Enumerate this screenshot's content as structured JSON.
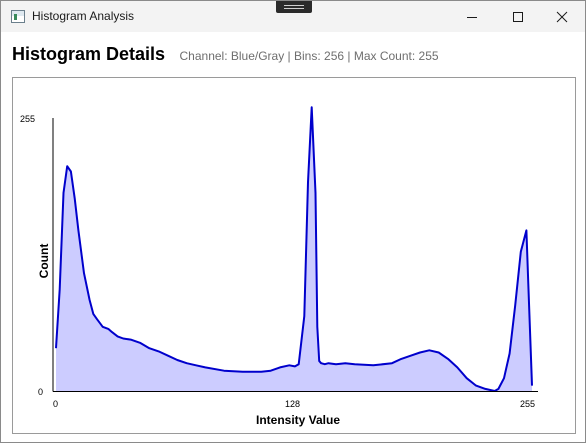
{
  "window": {
    "title": "Histogram Analysis"
  },
  "header": {
    "title": "Histogram Details",
    "subtitle": "Channel: Blue/Gray | Bins: 256 | Max Count: 255"
  },
  "colors": {
    "line": "#0000cc",
    "fill": "#ccccff",
    "axis": "#000000"
  },
  "chart_data": {
    "type": "area",
    "xlabel": "Intensity Value",
    "ylabel": "Count",
    "xlim": [
      0,
      255
    ],
    "ylim": [
      0,
      255
    ],
    "x_ticks": [
      "0",
      "128",
      "255"
    ],
    "y_ticks": [
      "0",
      "255"
    ],
    "grid": false,
    "x": [
      0,
      2,
      4,
      6,
      8,
      10,
      12,
      15,
      18,
      20,
      22,
      25,
      28,
      30,
      33,
      36,
      40,
      45,
      50,
      55,
      60,
      65,
      70,
      75,
      80,
      90,
      100,
      110,
      115,
      120,
      125,
      128,
      130,
      133,
      135,
      137,
      139,
      140,
      141,
      142,
      144,
      146,
      150,
      155,
      160,
      170,
      180,
      185,
      190,
      195,
      200,
      205,
      210,
      215,
      220,
      225,
      230,
      235,
      237,
      240,
      243,
      246,
      249,
      252,
      253,
      255
    ],
    "values": [
      40,
      95,
      185,
      210,
      205,
      180,
      150,
      110,
      85,
      72,
      67,
      60,
      58,
      55,
      51,
      49,
      48,
      45,
      40,
      37,
      33,
      29,
      26,
      24,
      22,
      19,
      18,
      18,
      19,
      22,
      24,
      23,
      25,
      70,
      195,
      265,
      185,
      60,
      28,
      26,
      25,
      26,
      25,
      26,
      25,
      24,
      26,
      30,
      33,
      36,
      38,
      36,
      30,
      22,
      12,
      5,
      2,
      0,
      2,
      12,
      35,
      80,
      130,
      150,
      100,
      5
    ]
  }
}
